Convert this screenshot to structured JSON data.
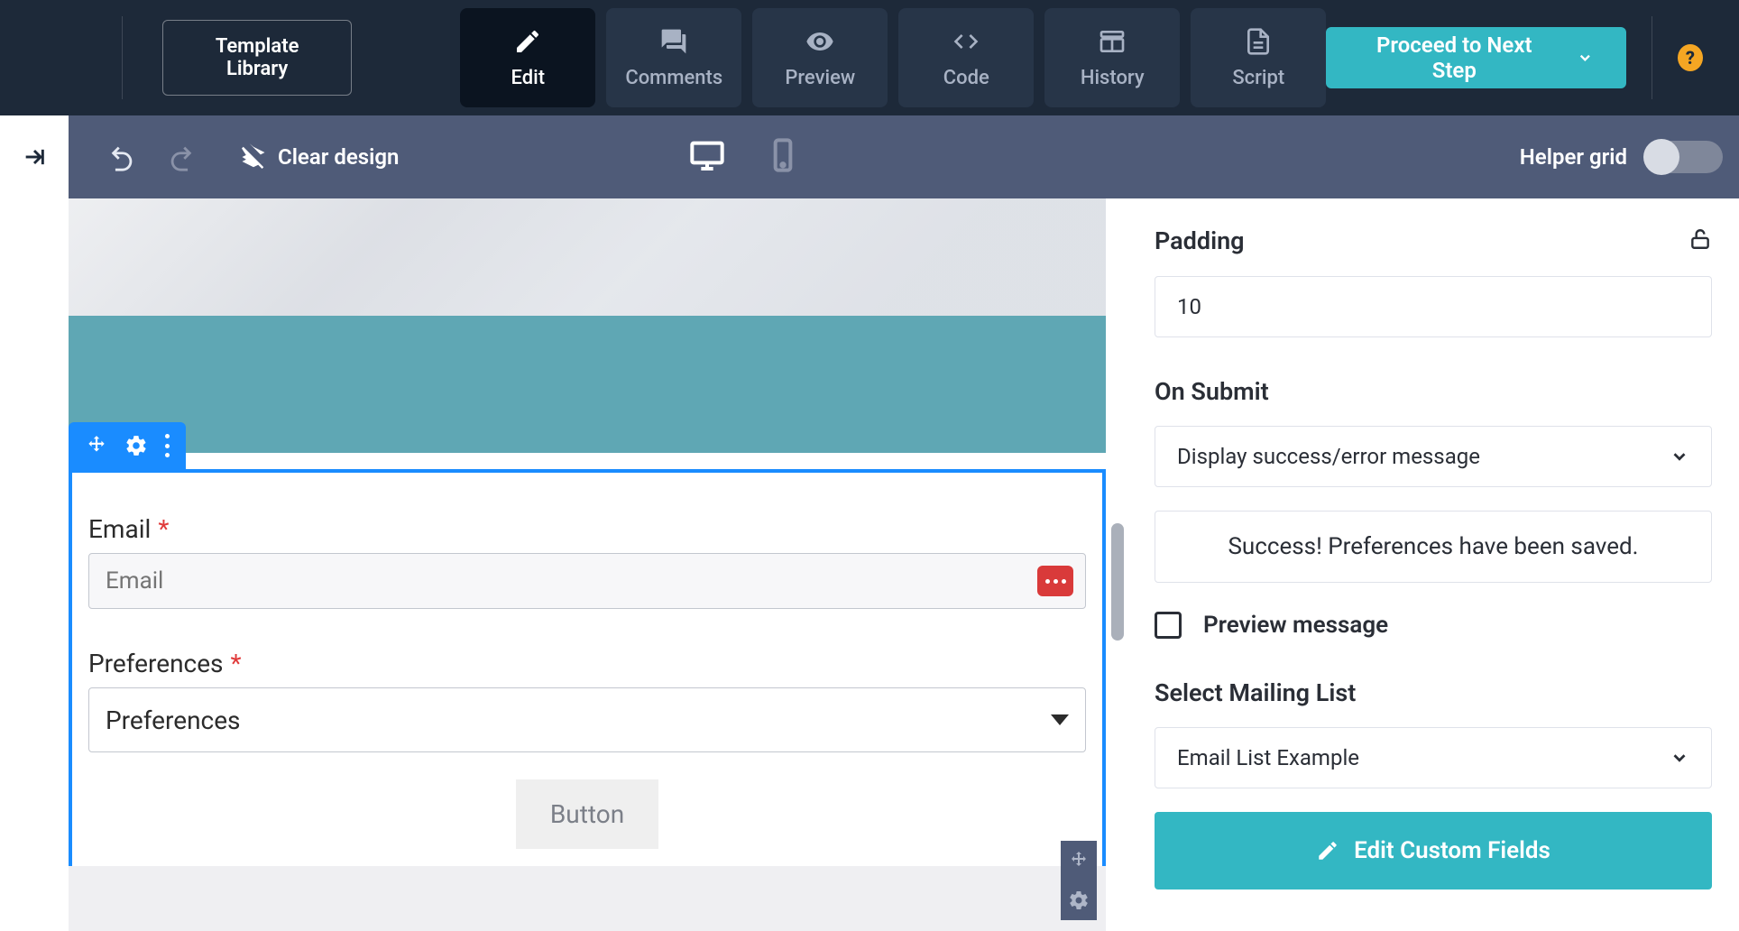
{
  "header": {
    "template_library": "Template Library",
    "tabs": [
      {
        "id": "edit",
        "label": "Edit",
        "active": true
      },
      {
        "id": "comments",
        "label": "Comments",
        "active": false
      },
      {
        "id": "preview",
        "label": "Preview",
        "active": false
      },
      {
        "id": "code",
        "label": "Code",
        "active": false
      },
      {
        "id": "history",
        "label": "History",
        "active": false
      },
      {
        "id": "script",
        "label": "Script",
        "active": false
      }
    ],
    "proceed": "Proceed to Next Step",
    "help": "?"
  },
  "toolbar": {
    "clear_design": "Clear design",
    "helper_grid": "Helper grid",
    "helper_grid_on": false,
    "device": "desktop"
  },
  "canvas": {
    "form": {
      "email_label": "Email",
      "email_placeholder": "Email",
      "preferences_label": "Preferences",
      "preferences_value": "Preferences",
      "button_label": "Button"
    }
  },
  "sidebar": {
    "padding_label": "Padding",
    "padding_value": "10",
    "on_submit_label": "On Submit",
    "on_submit_value": "Display success/error message",
    "success_message": "Success! Preferences have been saved.",
    "preview_message": "Preview message",
    "select_list_label": "Select Mailing List",
    "select_list_value": "Email List Example",
    "edit_custom_fields": "Edit Custom Fields"
  }
}
